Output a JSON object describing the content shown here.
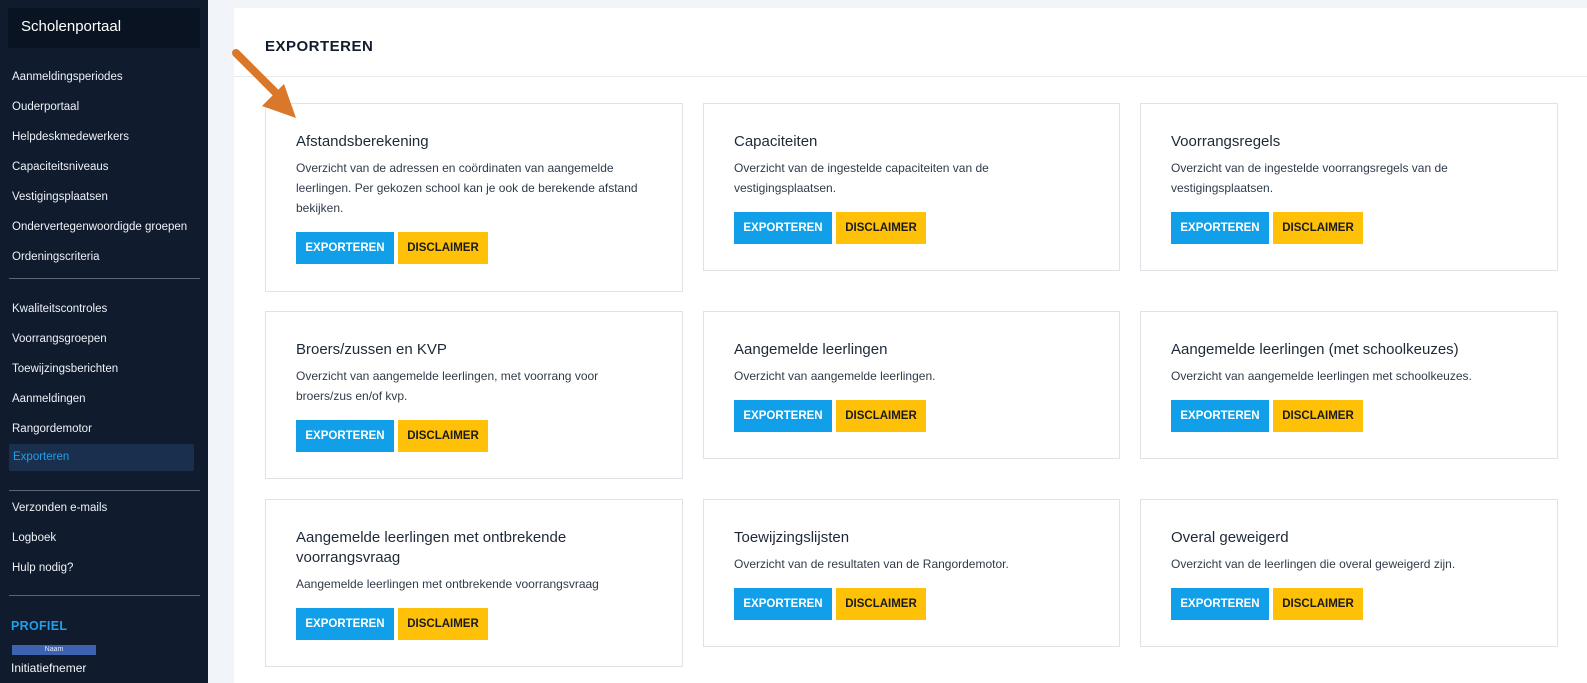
{
  "sidebar": {
    "brand": "Scholenportaal",
    "group1": [
      "Aanmeldingsperiodes",
      "Ouderportaal",
      "Helpdeskmedewerkers",
      "Capaciteitsniveaus",
      "Vestigingsplaatsen",
      "Ondervertegenwoordigde groepen",
      "Ordeningscriteria"
    ],
    "group2": [
      "Kwaliteitscontroles",
      "Voorrangsgroepen",
      "Toewijzingsberichten",
      "Aanmeldingen",
      "Rangordemotor",
      "Exporteren"
    ],
    "active": "Exporteren",
    "group3": [
      "Verzonden e-mails",
      "Logboek",
      "Hulp nodig?"
    ],
    "profile": {
      "title": "PROFIEL",
      "badge": "Naam",
      "role": "Initiatiefnemer"
    }
  },
  "main": {
    "title": "EXPORTEREN",
    "cards": [
      {
        "title": "Afstandsberekening",
        "description": "Overzicht van de adressen en coördinaten van aangemelde leerlingen. Per gekozen school kan je ook de berekende afstand bekijken.",
        "export_label": "EXPORTEREN",
        "disclaimer_label": "DISCLAIMER"
      },
      {
        "title": "Capaciteiten",
        "description": "Overzicht van de ingestelde capaciteiten van de vestigingsplaatsen.",
        "export_label": "EXPORTEREN",
        "disclaimer_label": "DISCLAIMER"
      },
      {
        "title": "Voorrangsregels",
        "description": "Overzicht van de ingestelde voorrangsregels van de vestigingsplaatsen.",
        "export_label": "EXPORTEREN",
        "disclaimer_label": "DISCLAIMER"
      },
      {
        "title": "Broers/zussen en KVP",
        "description": "Overzicht van aangemelde leerlingen, met voorrang voor broers/zus en/of kvp.",
        "export_label": "EXPORTEREN",
        "disclaimer_label": "DISCLAIMER"
      },
      {
        "title": "Aangemelde leerlingen",
        "description": "Overzicht van aangemelde leerlingen.",
        "export_label": "EXPORTEREN",
        "disclaimer_label": "DISCLAIMER"
      },
      {
        "title": "Aangemelde leerlingen (met schoolkeuzes)",
        "description": "Overzicht van aangemelde leerlingen met schoolkeuzes.",
        "export_label": "EXPORTEREN",
        "disclaimer_label": "DISCLAIMER"
      },
      {
        "title": "Aangemelde leerlingen met ontbrekende voorrangsvraag",
        "description": "Aangemelde leerlingen met ontbrekende voorrangsvraag",
        "export_label": "EXPORTEREN",
        "disclaimer_label": "DISCLAIMER"
      },
      {
        "title": "Toewijzingslijsten",
        "description": "Overzicht van de resultaten van de Rangordemotor.",
        "export_label": "EXPORTEREN",
        "disclaimer_label": "DISCLAIMER"
      },
      {
        "title": "Overal geweigerd",
        "description": "Overzicht van de leerlingen die overal geweigerd zijn.",
        "export_label": "EXPORTEREN",
        "disclaimer_label": "DISCLAIMER"
      }
    ]
  },
  "colors": {
    "sidebar_bg": "#101b2d",
    "active_text": "#21a0e8",
    "export_button": "#119fe9",
    "disclaimer_button": "#ffc107",
    "annotation_arrow": "#d9772a"
  },
  "annotation": {
    "icon": "arrow-icon"
  }
}
